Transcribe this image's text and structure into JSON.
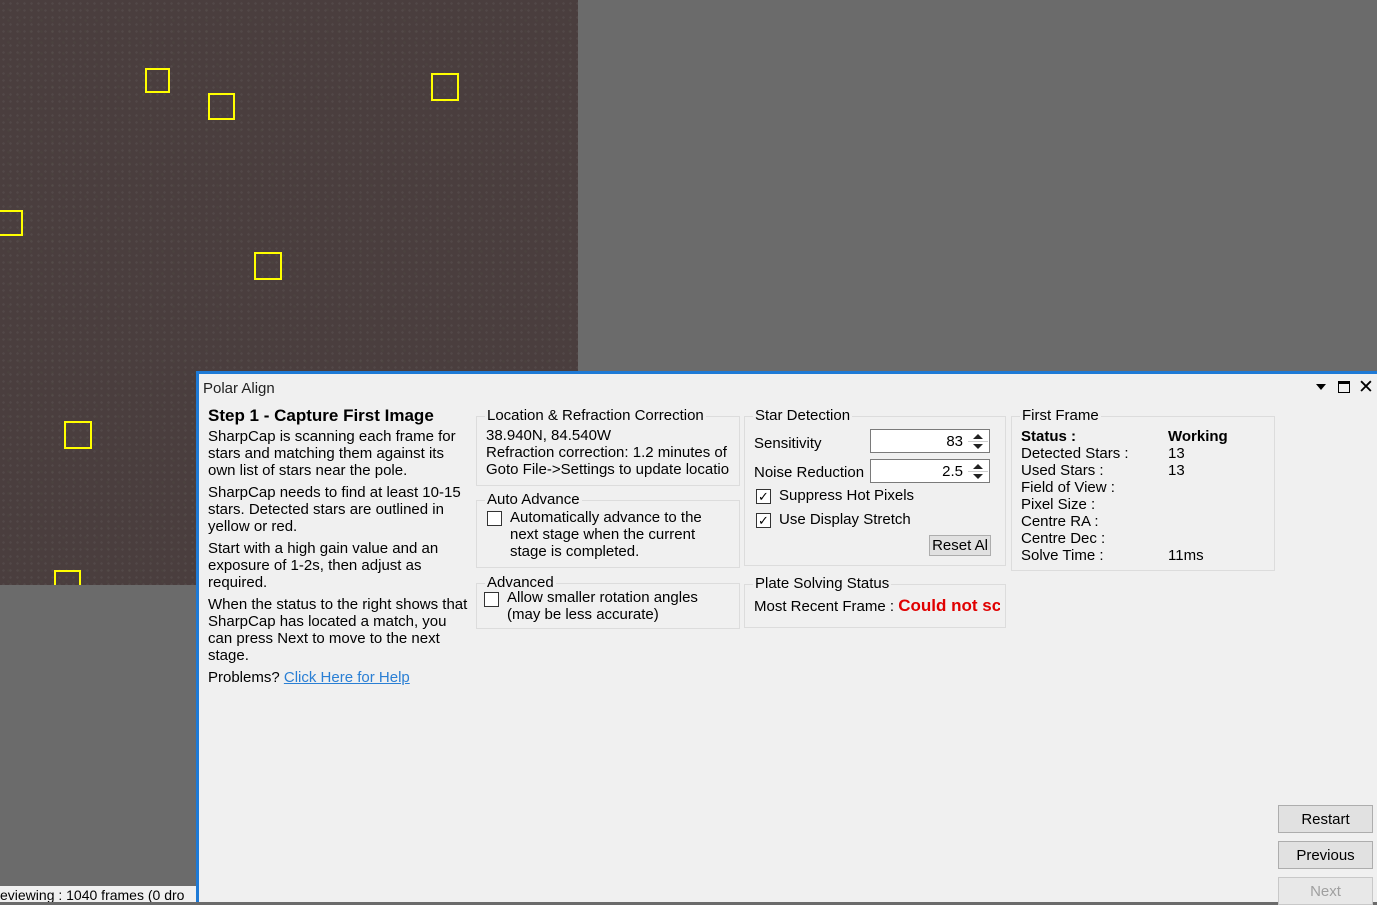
{
  "status_bar": {
    "text": "eviewing : 1040 frames (0 dro"
  },
  "window": {
    "title": "Polar Align",
    "close_glyph": "✕"
  },
  "instructions": {
    "title": "Step 1 - Capture First Image",
    "p1": "SharpCap is scanning each frame for stars and matching them against its own list of stars near the pole.",
    "p2": "SharpCap needs to find at least 10-15 stars. Detected stars are outlined in yellow or red.",
    "p3": "Start with a high gain value and an exposure of 1-2s, then adjust as required.",
    "p4": "When the status to the right shows that SharpCap has located a match, you can press Next to move to the next stage.",
    "problems_label": "Problems?",
    "help_link": "Click Here for Help"
  },
  "location": {
    "legend": "Location & Refraction Correction",
    "coords": "38.940N, 84.540W",
    "refraction": "Refraction correction: 1.2 minutes of",
    "settings_hint": "Goto File->Settings to update locatio"
  },
  "auto_advance": {
    "legend": "Auto Advance",
    "checked": false,
    "label_line1": "Automatically advance to the",
    "label_line2": "next stage when the current",
    "label_line3": "stage is completed."
  },
  "advanced": {
    "legend": "Advanced",
    "checked": false,
    "label_line1": "Allow smaller rotation angles",
    "label_line2": "(may be less accurate)"
  },
  "star_detection": {
    "legend": "Star Detection",
    "sensitivity_label": "Sensitivity",
    "sensitivity_value": "83",
    "noise_label": "Noise Reduction",
    "noise_value": "2.5",
    "suppress_hot_pixels_label": "Suppress Hot Pixels",
    "suppress_hot_pixels_checked": true,
    "use_display_stretch_label": "Use Display Stretch",
    "use_display_stretch_checked": true,
    "reset_label": "Reset Al",
    "check_glyph": "✓"
  },
  "plate_solving": {
    "legend": "Plate Solving Status",
    "recent_label": "Most Recent Frame :",
    "recent_value": "Could not sc",
    "error_color": "#e00000"
  },
  "first_frame": {
    "legend": "First Frame",
    "status_label": "Status :",
    "status_value": "Working",
    "detected_label": "Detected Stars :",
    "detected_value": "13",
    "used_label": "Used Stars :",
    "used_value": "13",
    "fov_label": "Field of View :",
    "pixel_label": "Pixel Size :",
    "ra_label": "Centre RA :",
    "dec_label": "Centre Dec :",
    "solve_label": "Solve Time :",
    "solve_value": "11ms"
  },
  "nav": {
    "restart_label": "Restart",
    "previous_label": "Previous",
    "next_label": "Next",
    "next_enabled": false
  },
  "colors": {
    "accent": "#1e7ad6",
    "star_outline": "#ffff00",
    "link": "#2a7fd4",
    "sky": "#4a3e3e",
    "workspace": "#6b6b6b"
  }
}
